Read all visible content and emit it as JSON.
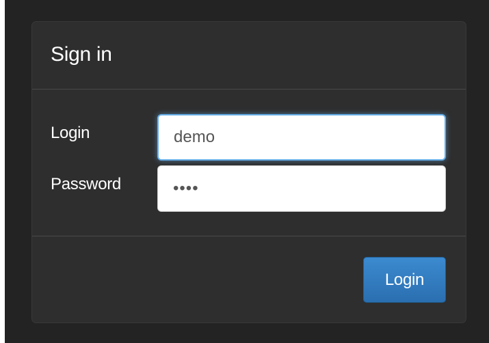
{
  "signin": {
    "title": "Sign in",
    "fields": {
      "login_label": "Login",
      "login_value": "demo",
      "password_label": "Password",
      "password_value": "••••"
    },
    "footer": {
      "submit_label": "Login"
    }
  },
  "colors": {
    "page_background": "#232323",
    "panel_background": "#2e2e2e",
    "primary_button": "#2f7cc1",
    "focus_ring": "#66afe9"
  }
}
